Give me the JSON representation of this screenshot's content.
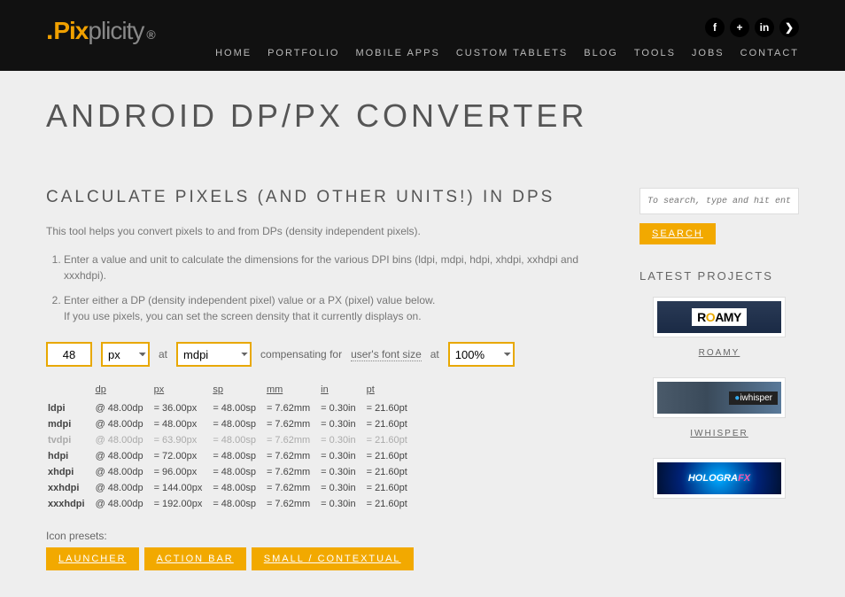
{
  "brand": {
    "pix": "Pix",
    "plicity": "plicity",
    "reg": "®"
  },
  "nav": {
    "items": [
      "HOME",
      "PORTFOLIO",
      "MOBILE APPS",
      "CUSTOM TABLETS",
      "BLOG",
      "TOOLS",
      "JOBS",
      "CONTACT"
    ]
  },
  "social": [
    "f",
    "+",
    "in",
    "❯"
  ],
  "page_title": "ANDROID DP/PX CONVERTER",
  "section_title": "CALCULATE PIXELS (AND OTHER UNITS!) IN DPS",
  "intro": "This tool helps you convert pixels to and from DPs (density independent pixels).",
  "steps": [
    "Enter a value and unit to calculate the dimensions for the various DPI bins (ldpi, mdpi, hdpi, xhdpi, xxhdpi and xxxhdpi).",
    "Enter either a DP (density independent pixel) value or a PX (pixel) value below.\nIf you use pixels, you can set the screen density that it currently displays on."
  ],
  "inputs": {
    "value": "48",
    "unit": "px",
    "at_label": "at",
    "density": "mdpi",
    "comp_label": "compensating for",
    "font_link": "user's font size",
    "at_label2": "at",
    "percent": "100%"
  },
  "table": {
    "headers": [
      "dp",
      "px",
      "sp",
      "mm",
      "in",
      "pt"
    ],
    "rows": [
      {
        "label": "ldpi",
        "at": "@ 48.00dp",
        "px": "= 36.00px",
        "sp": "= 48.00sp",
        "mm": "= 7.62mm",
        "in": "= 0.30in",
        "pt": "= 21.60pt",
        "muted": false
      },
      {
        "label": "mdpi",
        "at": "@ 48.00dp",
        "px": "= 48.00px",
        "sp": "= 48.00sp",
        "mm": "= 7.62mm",
        "in": "= 0.30in",
        "pt": "= 21.60pt",
        "muted": false
      },
      {
        "label": "tvdpi",
        "at": "@ 48.00dp",
        "px": "= 63.90px",
        "sp": "= 48.00sp",
        "mm": "= 7.62mm",
        "in": "= 0.30in",
        "pt": "= 21.60pt",
        "muted": true
      },
      {
        "label": "hdpi",
        "at": "@ 48.00dp",
        "px": "= 72.00px",
        "sp": "= 48.00sp",
        "mm": "= 7.62mm",
        "in": "= 0.30in",
        "pt": "= 21.60pt",
        "muted": false
      },
      {
        "label": "xhdpi",
        "at": "@ 48.00dp",
        "px": "= 96.00px",
        "sp": "= 48.00sp",
        "mm": "= 7.62mm",
        "in": "= 0.30in",
        "pt": "= 21.60pt",
        "muted": false
      },
      {
        "label": "xxhdpi",
        "at": "@ 48.00dp",
        "px": "= 144.00px",
        "sp": "= 48.00sp",
        "mm": "= 7.62mm",
        "in": "= 0.30in",
        "pt": "= 21.60pt",
        "muted": false
      },
      {
        "label": "xxxhdpi",
        "at": "@ 48.00dp",
        "px": "= 192.00px",
        "sp": "= 48.00sp",
        "mm": "= 7.62mm",
        "in": "= 0.30in",
        "pt": "= 21.60pt",
        "muted": false
      }
    ]
  },
  "presets": {
    "label": "Icon presets:",
    "buttons": [
      "LAUNCHER",
      "ACTION BAR",
      "SMALL / CONTEXTUAL"
    ]
  },
  "sidebar": {
    "search_placeholder": "To search, type and hit enter.",
    "search_button": "SEARCH",
    "latest_title": "LATEST PROJECTS",
    "projects": [
      {
        "name": "ROAMY"
      },
      {
        "name": "IWHISPER"
      },
      {
        "name": ""
      }
    ]
  }
}
